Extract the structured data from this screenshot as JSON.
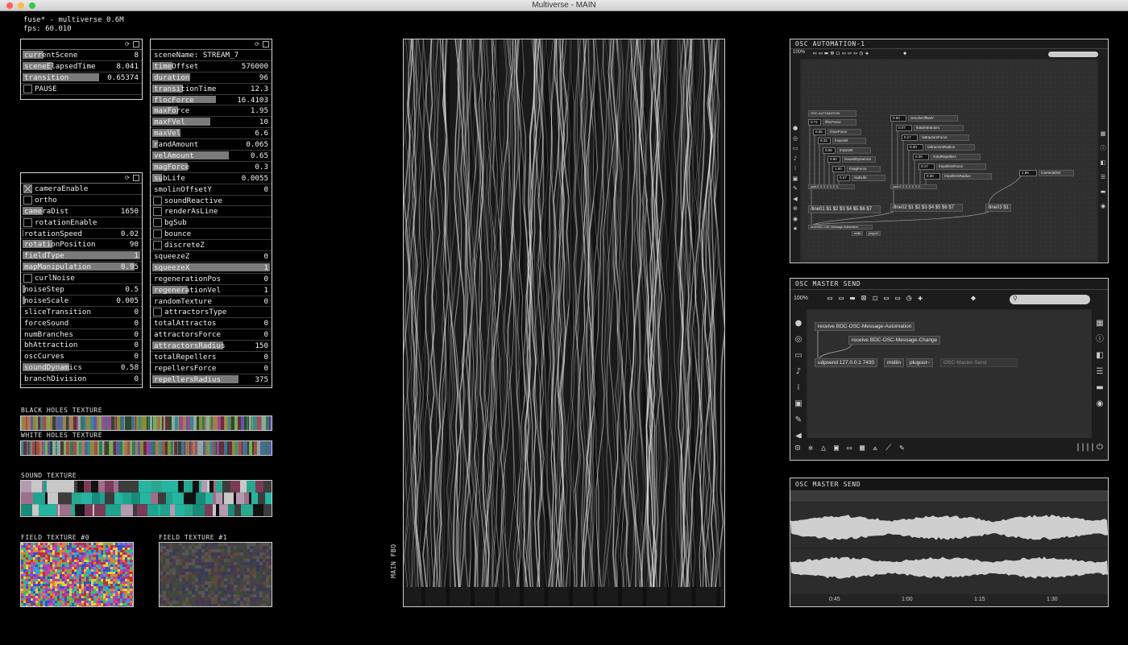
{
  "window": {
    "title": "Multiverse - MAIN"
  },
  "hud": {
    "line1": "fuse* - multiverse 0.6M",
    "line2": "fps: 60.010"
  },
  "panel1": {
    "rows": [
      {
        "label": "currentScene",
        "value": "8",
        "fill": 0.18
      },
      {
        "label": "sceneElapsedTime",
        "value": "8.041",
        "fill": 0.25
      },
      {
        "label": "transition",
        "value": "0.65374",
        "fill": 0.65
      }
    ],
    "toggle": {
      "label": "PAUSE",
      "on": false
    }
  },
  "panel2": {
    "header": "sceneName: STREAM_7",
    "sliders": [
      {
        "label": "timeOffset",
        "value": "576000",
        "fill": 0.17
      },
      {
        "label": "duration",
        "value": "96",
        "fill": 0.32
      },
      {
        "label": "transitionTime",
        "value": "12.3",
        "fill": 0.26
      },
      {
        "label": "flocForce",
        "value": "16.4103",
        "fill": 0.54
      },
      {
        "label": "maxForce",
        "value": "1.95",
        "fill": 0.22
      },
      {
        "label": "maxFVel",
        "value": "10",
        "fill": 0.49
      },
      {
        "label": "maxVel",
        "value": "6.6",
        "fill": 0.24
      },
      {
        "label": "randAmount",
        "value": "0.065",
        "fill": 0.05
      },
      {
        "label": "velAmount",
        "value": "0.65",
        "fill": 0.65
      },
      {
        "label": "magForce",
        "value": "0.3",
        "fill": 0.3
      },
      {
        "label": "subLife",
        "value": "0.0055",
        "fill": 0.08
      },
      {
        "label": "smolinOffsetY",
        "value": "0",
        "fill": 0
      }
    ],
    "toggles": [
      {
        "label": "soundReactive",
        "on": false
      },
      {
        "label": "renderAsLine",
        "on": false
      },
      {
        "label": "bgSub",
        "on": false
      },
      {
        "label": "bounce",
        "on": false
      },
      {
        "label": "discreteZ",
        "on": false
      }
    ],
    "sliders2": [
      {
        "label": "squeezeZ",
        "value": "0",
        "fill": 0
      },
      {
        "label": "squeezeX",
        "value": "1",
        "fill": 1.0
      },
      {
        "label": "regenerationPos",
        "value": "0",
        "fill": 0
      },
      {
        "label": "regenerationVel",
        "value": "1",
        "fill": 0.3
      },
      {
        "label": "randomTexture",
        "value": "0",
        "fill": 0
      }
    ],
    "toggle_attr": {
      "label": "attractorsType",
      "on": false
    },
    "sliders3": [
      {
        "label": "totalAttractos",
        "value": "0",
        "fill": 0
      },
      {
        "label": "attractorsForce",
        "value": "0",
        "fill": 0
      },
      {
        "label": "attractorsRadius",
        "value": "150",
        "fill": 0.6
      },
      {
        "label": "totalRepellers",
        "value": "0",
        "fill": 0
      },
      {
        "label": "repellersForce",
        "value": "0",
        "fill": 0
      },
      {
        "label": "repellersRadius",
        "value": "375",
        "fill": 0.73
      }
    ]
  },
  "panel3": {
    "toggles_top": [
      {
        "label": "cameraEnable",
        "on": true
      },
      {
        "label": "ortho",
        "on": false
      }
    ],
    "cameraDist": {
      "label": "cameraDist",
      "value": "1650",
      "fill": 0.17
    },
    "rotationEnable": {
      "label": "rotationEnable",
      "on": false
    },
    "sliders": [
      {
        "label": "rotationSpeed",
        "value": "0.02",
        "fill": 0.01
      },
      {
        "label": "rotationPosition",
        "value": "90",
        "fill": 0.25
      },
      {
        "label": "fieldType",
        "value": "1",
        "fill": 1.0
      },
      {
        "label": "mapManipulation",
        "value": "0.95",
        "fill": 0.95
      }
    ],
    "curlNoise": {
      "label": "curlNoise",
      "on": false
    },
    "sliders2": [
      {
        "label": "noiseStep",
        "value": "0.5",
        "fill": 0.02
      },
      {
        "label": "noiseScale",
        "value": "0.005",
        "fill": 0.02
      },
      {
        "label": "sliceTransition",
        "value": "0",
        "fill": 0
      },
      {
        "label": "forceSound",
        "value": "0",
        "fill": 0
      },
      {
        "label": "numBranches",
        "value": "0",
        "fill": 0
      },
      {
        "label": "bhAttraction",
        "value": "0",
        "fill": 0
      },
      {
        "label": "oscCurves",
        "value": "0",
        "fill": 0
      },
      {
        "label": "soundDynamics",
        "value": "0.58",
        "fill": 0.4
      },
      {
        "label": "branchDivision",
        "value": "0",
        "fill": 0
      }
    ]
  },
  "textures": {
    "black_holes": "BLACK  HOLES  TEXTURE",
    "white_holes": "WHITE  HOLES  TEXTURE",
    "sound": "SOUND  TEXTURE",
    "field0": "FIELD  TEXTURE  #0",
    "field1": "FIELD  TEXTURE  #1"
  },
  "fbo": {
    "label": "MAIN  FBO"
  },
  "osc_automation": {
    "title": "OSC  AUTOMATION-1",
    "zoom": "100%",
    "header_node": "OSC-AUTOMATION",
    "col1": [
      {
        "num": "0.71",
        "label": "/flocForce"
      },
      {
        "num": "0.55",
        "label": "/maxForce"
      },
      {
        "num": "0.33",
        "label": "/maxVel"
      },
      {
        "num": "0.06",
        "label": "/maxVel"
      },
      {
        "num": "0.90",
        "label": "/soundDynamics"
      },
      {
        "num": "1.00",
        "label": "/magForce"
      },
      {
        "num": "0.27",
        "label": "/subLife"
      }
    ],
    "col2": [
      {
        "num": "0.50",
        "label": "/smolinOffsetY"
      },
      {
        "num": "0.07",
        "label": "/totalAttractors"
      },
      {
        "num": "0.17",
        "label": "/attractorsForce"
      },
      {
        "num": "0.30",
        "label": "/attractorsRadius"
      },
      {
        "num": "0.30",
        "label": "/totalRepellers"
      },
      {
        "num": "0.17",
        "label": "/repellersForce"
      },
      {
        "num": "0.30",
        "label": "/repellersRadius"
      }
    ],
    "col3": {
      "num": "1.65",
      "label": "/cameraDist"
    },
    "pack1": "pack 0. 0. 0. 0. 0. 0. 0.",
    "pack2": "pack 0. 0. 0. 0. 0. 0. 0.",
    "line01": "/line01 $1 $2 $3 $4 $5 $6 $7",
    "line02": "/line02 $1 $2 $3 $4 $5 $6 $7",
    "line03": "/line03 $1",
    "send": "send BDC-OSC-Message-Automation",
    "midiin": "midiin",
    "plugout": "plugout~"
  },
  "osc_master": {
    "title": "OSC  MASTER  SEND",
    "zoom": "100%",
    "receive1": "receive BDC-OSC-Message-Automation",
    "receive2": "receive BDC-OSC-Message-Change",
    "udpsend": "udpsend 127.0.0.1 7430",
    "midiin": "midiin",
    "plugout": "plugout~",
    "comment": "OSC-Master-Send"
  },
  "osc_wave": {
    "title": "OSC  MASTER  SEND",
    "ticks": [
      "0:45",
      "1:00",
      "1:15",
      "1:30"
    ]
  }
}
